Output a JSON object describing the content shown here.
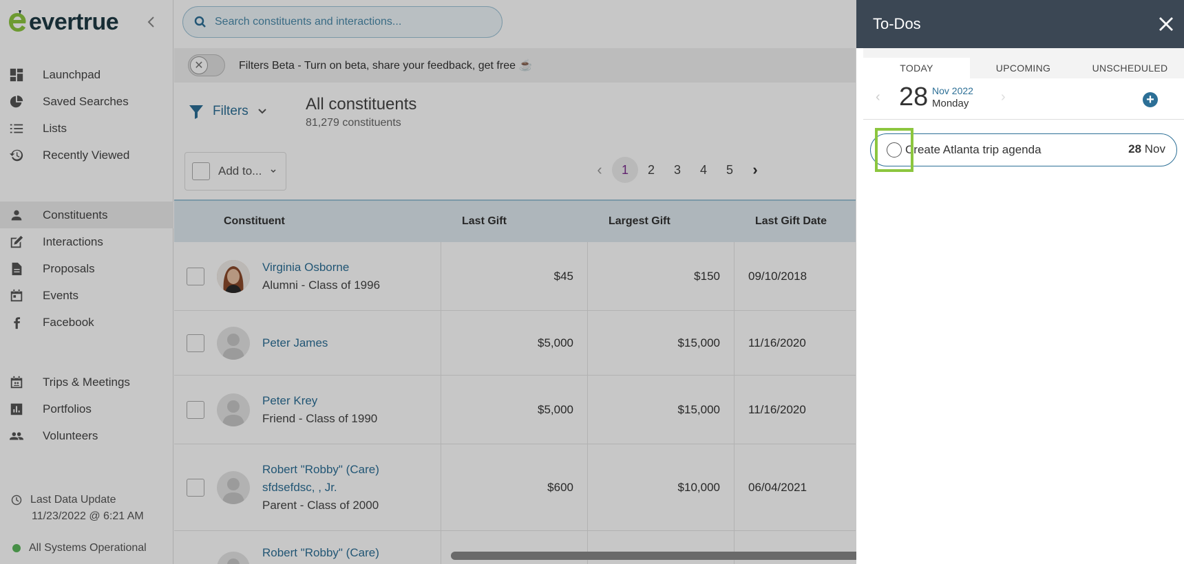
{
  "app": {
    "logo_text": "evertrue"
  },
  "search": {
    "placeholder": "Search constituents and interactions..."
  },
  "sidebar": {
    "items": [
      {
        "label": "Launchpad",
        "icon": "dashboard-icon"
      },
      {
        "label": "Saved Searches",
        "icon": "pie-chart-icon"
      },
      {
        "label": "Lists",
        "icon": "list-icon"
      },
      {
        "label": "Recently Viewed",
        "icon": "history-icon"
      }
    ],
    "items2": [
      {
        "label": "Constituents",
        "icon": "person-icon",
        "active": true
      },
      {
        "label": "Interactions",
        "icon": "edit-icon"
      },
      {
        "label": "Proposals",
        "icon": "document-icon"
      },
      {
        "label": "Events",
        "icon": "calendar-icon"
      },
      {
        "label": "Facebook",
        "icon": "facebook-icon"
      }
    ],
    "items3": [
      {
        "label": "Trips & Meetings",
        "icon": "calendar-people-icon"
      },
      {
        "label": "Portfolios",
        "icon": "bar-chart-icon"
      },
      {
        "label": "Volunteers",
        "icon": "group-icon"
      }
    ],
    "last_update_label": "Last Data Update",
    "last_update_value": "11/23/2022 @ 6:21 AM",
    "status": "All Systems Operational",
    "status_color": "#5cb85c"
  },
  "beta": {
    "text": "Filters Beta - Turn on beta, share your feedback, get free ☕"
  },
  "filters": {
    "label": "Filters"
  },
  "header": {
    "title": "All constituents",
    "count": "81,279 constituents"
  },
  "toolbar": {
    "add_to": "Add to..."
  },
  "pagination": {
    "pages": [
      "1",
      "2",
      "3",
      "4",
      "5"
    ],
    "current": "1"
  },
  "table": {
    "columns": [
      "Constituent",
      "Last Gift",
      "Largest Gift",
      "Last Gift Date"
    ],
    "rows": [
      {
        "name": "Virginia Osborne",
        "sub": "Alumni - Class of 1996",
        "last_gift": "$45",
        "largest_gift": "$150",
        "date": "09/10/2018",
        "photo": true
      },
      {
        "name": "Peter James",
        "sub": "",
        "last_gift": "$5,000",
        "largest_gift": "$15,000",
        "date": "11/16/2020"
      },
      {
        "name": "Peter Krey",
        "sub": "Friend - Class of 1990",
        "last_gift": "$5,000",
        "largest_gift": "$15,000",
        "date": "11/16/2020"
      },
      {
        "name": "Robert \"Robby\" (Care)",
        "name2": "sfdsefdsc, , Jr.",
        "sub": "Parent - Class of 2000",
        "last_gift": "$600",
        "largest_gift": "$10,000",
        "date": "06/04/2021"
      },
      {
        "name": "Robert \"Robby\" (Care)",
        "sub": "",
        "last_gift": "",
        "largest_gift": "",
        "date": ""
      }
    ]
  },
  "todos": {
    "title": "To-Dos",
    "tabs": [
      "TODAY",
      "UPCOMING",
      "UNSCHEDULED"
    ],
    "active_tab": "TODAY",
    "date": {
      "day_num": "28",
      "month_year": "Nov 2022",
      "weekday": "Monday"
    },
    "items": [
      {
        "text": "Create Atlanta trip agenda",
        "due_day": "28",
        "due_month": "Nov"
      }
    ]
  }
}
